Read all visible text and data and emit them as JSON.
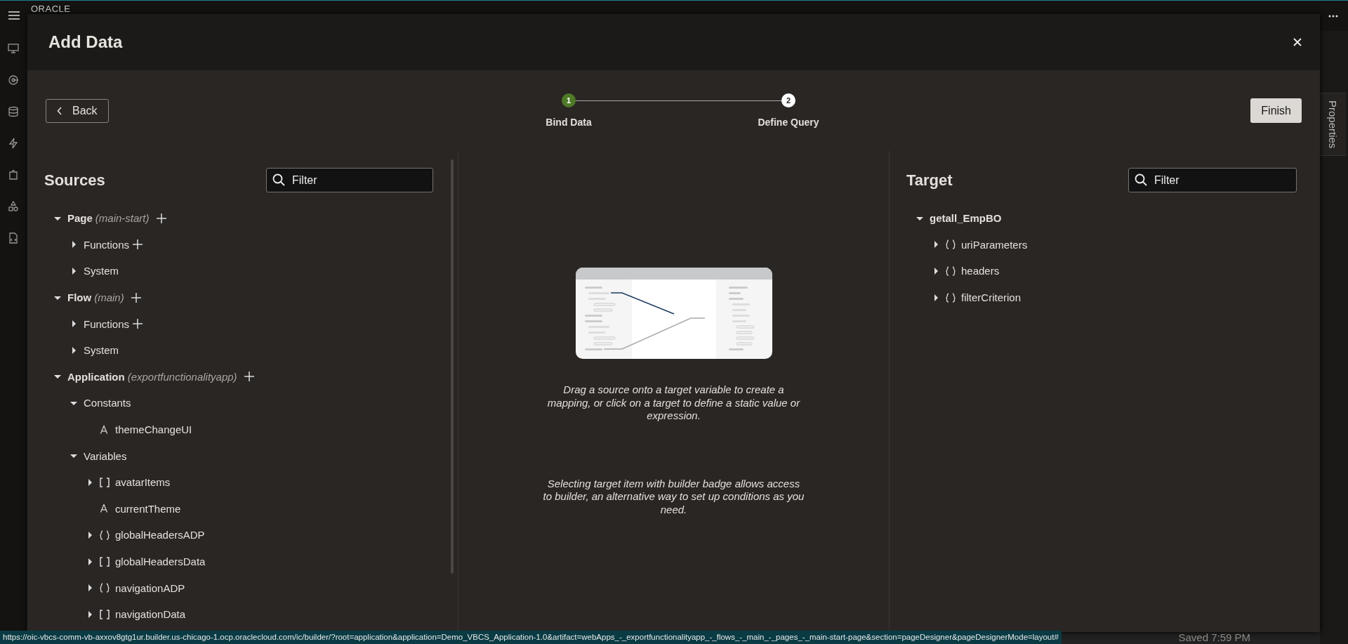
{
  "app_bar": {
    "logo": "ORACLE"
  },
  "dialog": {
    "title": "Add Data",
    "back": "Back",
    "finish": "Finish",
    "steps": [
      {
        "number": "1",
        "label": "Bind Data",
        "selected": true
      },
      {
        "number": "2",
        "label": "Define Query",
        "selected": false
      }
    ]
  },
  "sources": {
    "title": "Sources",
    "filter": {
      "placeholder": "Filter"
    },
    "tree": [
      {
        "label": "Page",
        "context": "(main-start)",
        "addable": true,
        "expanded": true,
        "children": [
          {
            "label": "Functions",
            "addable": true,
            "expanded": false
          },
          {
            "label": "System",
            "expanded": false
          }
        ]
      },
      {
        "label": "Flow",
        "context": "(main)",
        "addable": true,
        "expanded": true,
        "children": [
          {
            "label": "Functions",
            "addable": true,
            "expanded": false
          },
          {
            "label": "System",
            "expanded": false
          }
        ]
      },
      {
        "label": "Application",
        "context": "(exportfunctionalityapp)",
        "addable": true,
        "expanded": true,
        "children": [
          {
            "label": "Constants",
            "expanded": true,
            "children": [
              {
                "label": "themeChangeUI",
                "kind": "string"
              }
            ]
          },
          {
            "label": "Variables",
            "expanded": true,
            "children": [
              {
                "label": "avatarItems",
                "kind": "array",
                "expanded": false
              },
              {
                "label": "currentTheme",
                "kind": "string"
              },
              {
                "label": "globalHeadersADP",
                "kind": "object",
                "expanded": false
              },
              {
                "label": "globalHeadersData",
                "kind": "array",
                "expanded": false
              },
              {
                "label": "navigationADP",
                "kind": "object",
                "expanded": false
              },
              {
                "label": "navigationData",
                "kind": "array",
                "expanded": false
              }
            ]
          }
        ]
      }
    ]
  },
  "hints": [
    "Drag a source onto a target variable to create a mapping, or click on a target to define a static value or expression.",
    "Selecting target item with builder badge allows access to builder, an alternative way to set up conditions as you need."
  ],
  "target": {
    "title": "Target",
    "filter": {
      "placeholder": "Filter"
    },
    "tree": [
      {
        "label": "getall_EmpBO",
        "expanded": true,
        "children": [
          {
            "label": "uriParameters",
            "kind": "object",
            "expanded": false
          },
          {
            "label": "headers",
            "kind": "object",
            "expanded": false
          },
          {
            "label": "filterCriterion",
            "kind": "object",
            "expanded": false
          }
        ]
      }
    ]
  },
  "side_tab": "Properties",
  "status_url": "https://oic-vbcs-comm-vb-axxov8gtg1ur.builder.us-chicago-1.ocp.oraclecloud.com/ic/builder/?root=application&application=Demo_VBCS_Application-1.0&artifact=webApps_-_exportfunctionalityapp_-_flows_-_main_-_pages_-_main-start-page&section=pageDesigner&pageDesignerMode=layout#",
  "saved": "Saved 7:59 PM"
}
